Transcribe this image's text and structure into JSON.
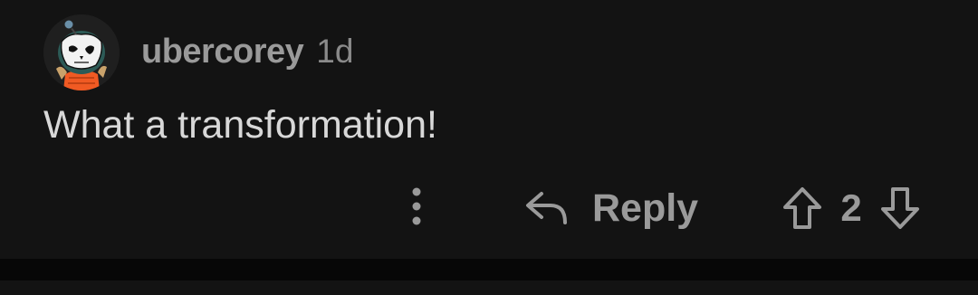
{
  "comment": {
    "author": "ubercorey",
    "age": "1d",
    "text": "What a transformation!",
    "score": "2",
    "avatar_icon": "snoo-avatar-icon"
  },
  "actions": {
    "more_icon": "more-vertical-icon",
    "reply_icon": "reply-arrow-icon",
    "reply_label": "Reply",
    "upvote_icon": "upvote-arrow-icon",
    "downvote_icon": "downvote-arrow-icon"
  },
  "colors": {
    "background": "#131313",
    "divider": "#070707",
    "muted_text": "#9a9a9a",
    "body_text": "#d8d8d8"
  }
}
